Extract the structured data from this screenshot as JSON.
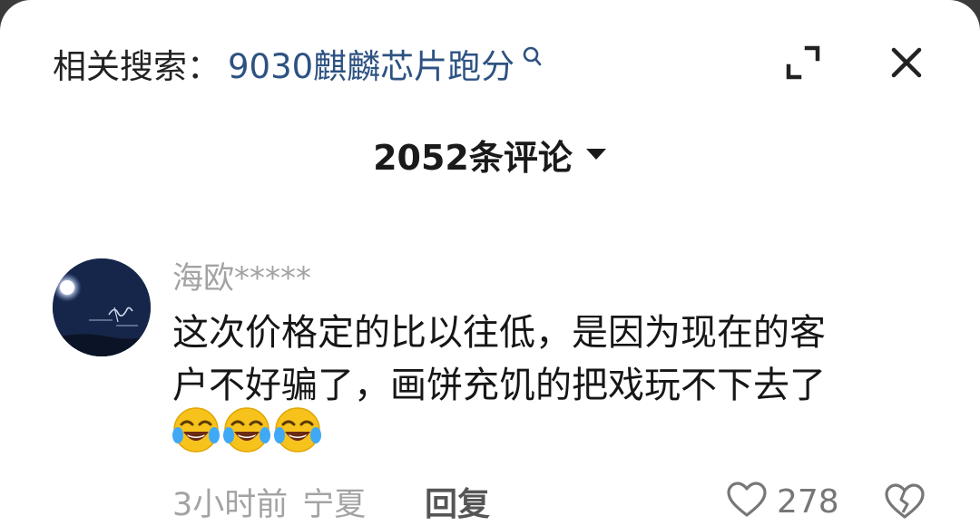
{
  "header": {
    "related_label": "相关搜索：",
    "related_query": "9030麒麟芯片跑分",
    "search_icon": "search-icon",
    "expand_icon": "expand-icon",
    "close_icon": "close-icon"
  },
  "comments_header": {
    "count_label": "2052条评论",
    "caret_icon": "caret-down-icon"
  },
  "comment": {
    "username": "海欧*****",
    "text_lines": [
      "这次价格定的比以往低，是因为现在的客",
      "户不好骗了，画饼充饥的把戏玩不下去了"
    ],
    "emojis": [
      "laughing-crying-emoji",
      "laughing-crying-emoji",
      "laughing-crying-emoji"
    ],
    "time": "3小时前",
    "location": "宁夏",
    "reply_label": "回复",
    "like_count": "278",
    "like_icon": "heart-icon",
    "dislike_icon": "broken-heart-icon"
  },
  "colors": {
    "link_blue": "#2d5282",
    "meta_gray": "#a3a3a3",
    "text_dark": "#161616"
  }
}
